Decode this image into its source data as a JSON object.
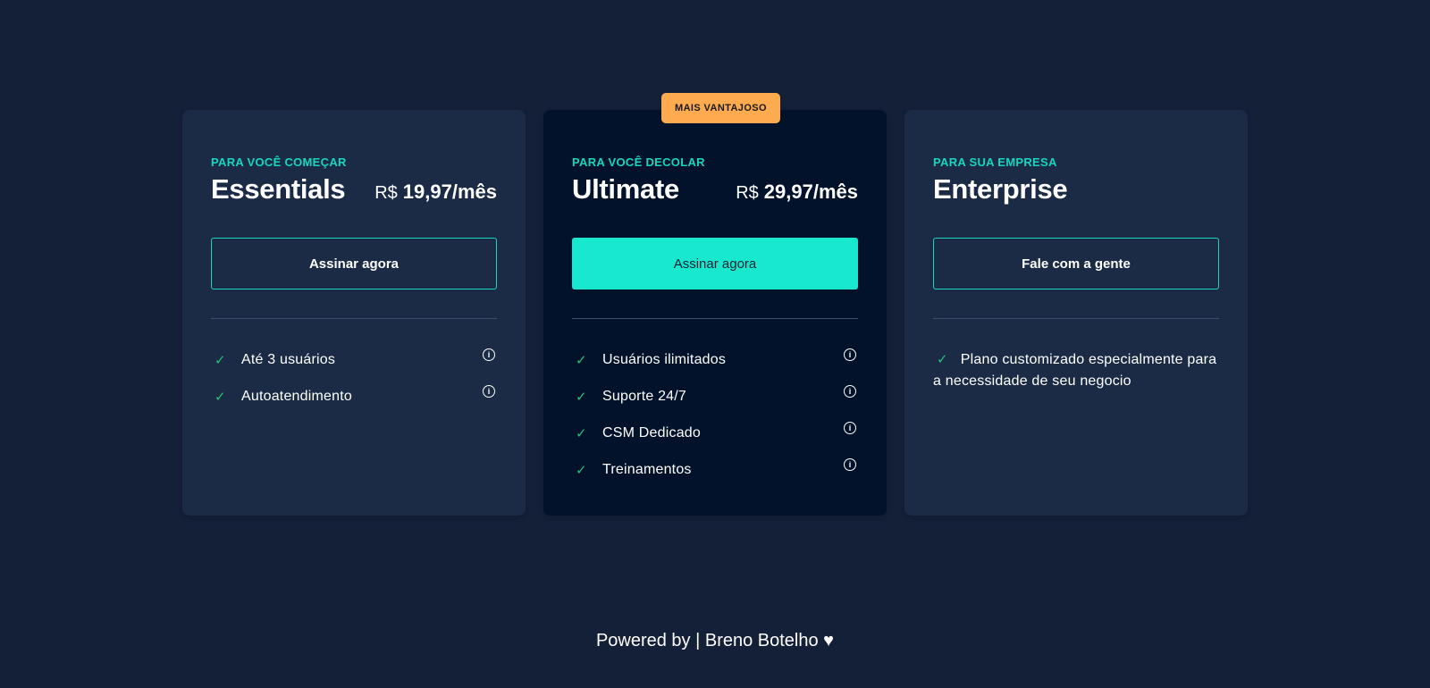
{
  "plans": [
    {
      "eyebrow": "PARA VOCÊ COMEÇAR",
      "name": "Essentials",
      "currency": "R$",
      "amount": "19,97/mês",
      "cta": "Assinar agora",
      "features": [
        "Até 3 usuários",
        "Autoatendimento"
      ]
    },
    {
      "badge": "MAIS VANTAJOSO",
      "eyebrow": "PARA VOCÊ DECOLAR",
      "name": "Ultimate",
      "currency": "R$",
      "amount": "29,97/mês",
      "cta": "Assinar agora",
      "features": [
        "Usuários ilimitados",
        "Suporte 24/7",
        "CSM Dedicado",
        "Treinamentos"
      ]
    },
    {
      "eyebrow": "PARA SUA EMPRESA",
      "name": "Enterprise",
      "cta": "Fale com a gente",
      "description": "Plano customizado especialmente para a necessidade de seu negocio"
    }
  ],
  "footer": {
    "text": "Powered by | Breno Botelho ♥"
  },
  "colors": {
    "background": "#141f38",
    "card": "#1b2b46",
    "card_featured": "#01122a",
    "accent": "#17e8ce",
    "badge": "#fdab4e",
    "check": "#25c178"
  },
  "icons": {
    "check": "check-icon",
    "info": "info-icon",
    "heart": "heart-icon"
  }
}
